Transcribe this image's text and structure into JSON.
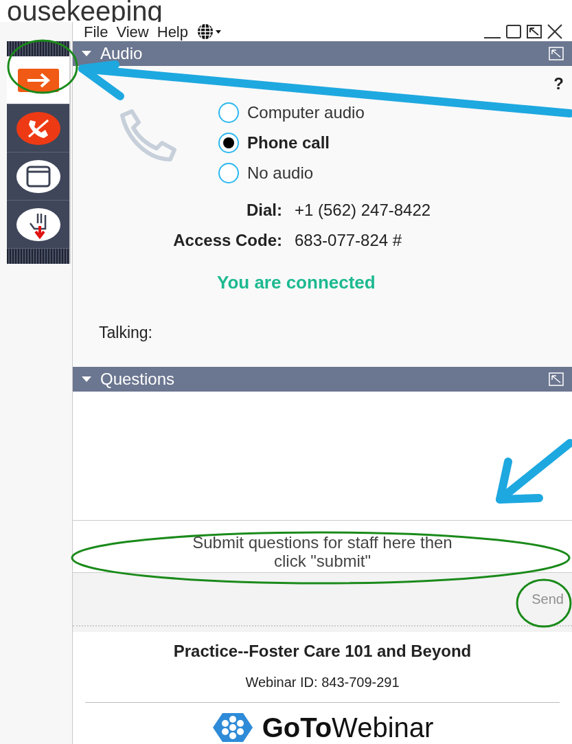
{
  "slide_title": "ousekeeping",
  "menu": [
    {
      "label": "File"
    },
    {
      "label": "View"
    },
    {
      "label": "Help"
    }
  ],
  "toolbar": [
    {
      "kind": "arrow",
      "selected": true
    },
    {
      "kind": "mute",
      "selected": false
    },
    {
      "kind": "screen",
      "selected": false
    },
    {
      "kind": "hand",
      "selected": false
    }
  ],
  "audio": {
    "title": "Audio",
    "expanded": true,
    "help": "?",
    "options": [
      {
        "label": "Computer audio",
        "selected": false
      },
      {
        "label": "Phone call",
        "selected": true
      },
      {
        "label": "No audio",
        "selected": false
      }
    ],
    "dial_label": "Dial:",
    "dial": "+1 (562) 247-8422",
    "access_label": "Access Code:",
    "access_code": "683-077-824 #",
    "status": "You are connected",
    "talking_label": "Talking:"
  },
  "questions": {
    "title": "Questions",
    "expanded": true,
    "input": {
      "placeholder": "Submit questions for staff here then click \"submit\""
    },
    "send": {
      "label": "Send",
      "disabled": true
    }
  },
  "footer": {
    "title": "Practice--Foster Care 101 and Beyond",
    "webinar_id": "Webinar ID: 843-709-291",
    "logo_bold": "GoTo",
    "logo_light": "Webinar"
  }
}
